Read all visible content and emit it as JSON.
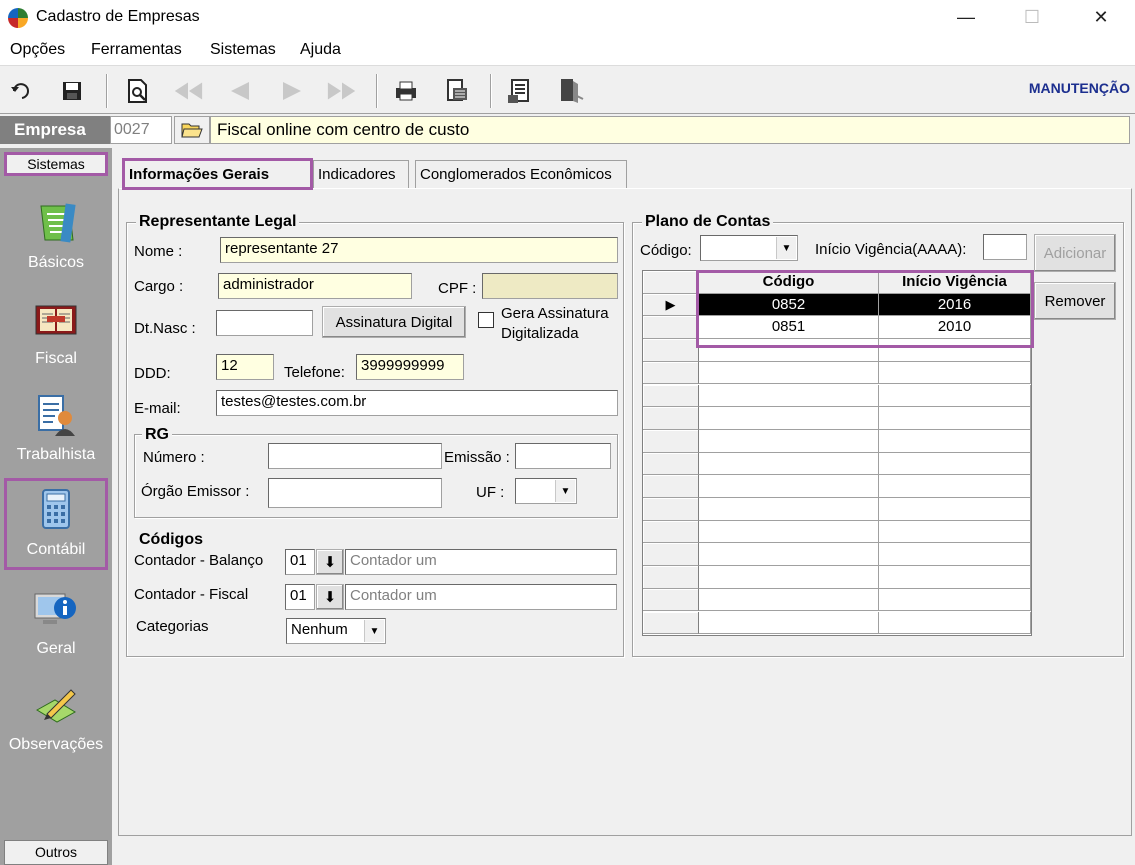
{
  "window": {
    "title": "Cadastro de Empresas",
    "minimize": "—",
    "maximize": "☐",
    "close": "✕"
  },
  "menu": [
    "Opções",
    "Ferramentas",
    "Sistemas",
    "Ajuda"
  ],
  "toolbar": {
    "mode": "MANUTENÇÃO"
  },
  "empresa": {
    "label": "Empresa",
    "code": "0027",
    "name": "Fiscal online com centro de custo"
  },
  "sidebar": {
    "header": "Sistemas",
    "footer": "Outros",
    "items": [
      {
        "label": "Básicos",
        "icon": "notebook-icon"
      },
      {
        "label": "Fiscal",
        "icon": "ledger-book-icon"
      },
      {
        "label": "Trabalhista",
        "icon": "worker-document-icon"
      },
      {
        "label": "Contábil",
        "icon": "calculator-icon"
      },
      {
        "label": "Geral",
        "icon": "info-monitor-icon"
      },
      {
        "label": "Observações",
        "icon": "pencil-note-icon"
      }
    ],
    "selected": "Contábil"
  },
  "tabs": [
    "Informações Gerais",
    "Indicadores",
    "Conglomerados Econômicos"
  ],
  "representante": {
    "title": "Representante Legal",
    "nome_label": "Nome :",
    "nome": "representante 27",
    "cargo_label": "Cargo :",
    "cargo": "administrador",
    "cpf_label": "CPF :",
    "cpf": "",
    "dtnasc_label": "Dt.Nasc :",
    "dtnasc": "",
    "assinatura_button": "Assinatura Digital",
    "gera_assinatura_line1": "Gera Assinatura",
    "gera_assinatura_line2": "Digitalizada",
    "ddd_label": "DDD:",
    "ddd": "12",
    "telefone_label": "Telefone:",
    "telefone": "3999999999",
    "email_label": "E-mail:",
    "email": "testes@testes.com.br"
  },
  "rg": {
    "title": "RG",
    "numero_label": "Número :",
    "numero": "",
    "emissao_label": "Emissão :",
    "emissao": "",
    "orgao_label": "Órgão Emissor :",
    "orgao": "",
    "uf_label": "UF :",
    "uf": ""
  },
  "codigos": {
    "title": "Códigos",
    "contador_balanco_label": "Contador - Balanço",
    "contador_balanco_code": "01",
    "contador_balanco_name": "Contador um",
    "contador_fiscal_label": "Contador - Fiscal",
    "contador_fiscal_code": "01",
    "contador_fiscal_name": "Contador um",
    "categorias_label": "Categorias",
    "categorias": "Nenhum"
  },
  "plano": {
    "title": "Plano de Contas",
    "codigo_label": "Código:",
    "codigo": "",
    "inicio_label": "Início Vigência(AAAA):",
    "inicio": "",
    "adicionar": "Adicionar",
    "remover": "Remover",
    "columns": [
      "Código",
      "Início Vigência"
    ],
    "rows": [
      [
        "0852",
        "2016"
      ],
      [
        "0851",
        "2010"
      ]
    ]
  }
}
